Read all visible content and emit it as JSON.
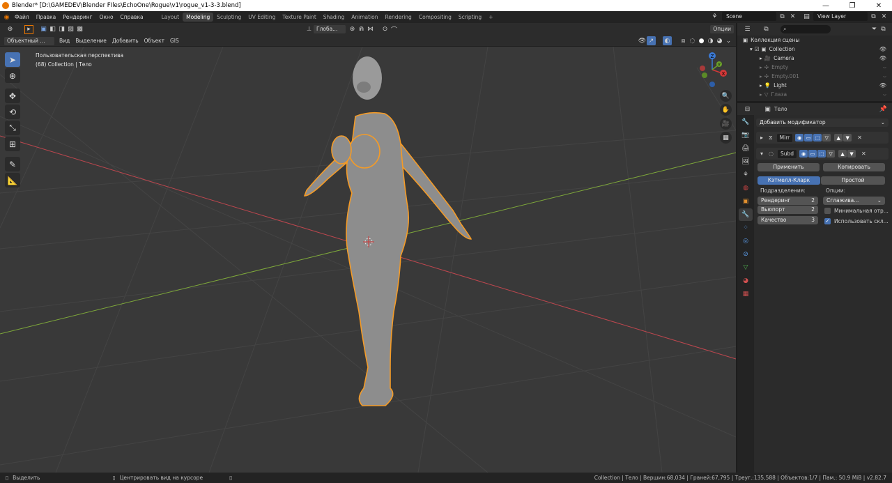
{
  "window": {
    "title": "Blender* [D:\\GAMEDEV\\Blender FIles\\EchoOne\\Rogue\\v1\\rogue_v1-3-3.blend]",
    "controls": [
      "—",
      "❐",
      "✕"
    ]
  },
  "topbar": {
    "menus": [
      "Файл",
      "Правка",
      "Рендеринг",
      "Окно",
      "Справка"
    ],
    "workspaces": [
      "Layout",
      "Modeling",
      "Sculpting",
      "UV Editing",
      "Texture Paint",
      "Shading",
      "Animation",
      "Rendering",
      "Compositing",
      "Scripting"
    ],
    "active_workspace": "Modeling",
    "add_tab": "+",
    "scene": "Scene",
    "view_layer": "View Layer"
  },
  "viewport_header": {
    "transform_orientation": "Глоба...",
    "options": "Опции",
    "mode": "Объектный ...",
    "menus": [
      "Вид",
      "Выделение",
      "Добавить",
      "Объект",
      "GIS"
    ]
  },
  "viewport": {
    "perspective_label": "Пользовательская перспектива",
    "collection_label": "(68) Collection | Тело",
    "gizmo": {
      "x": "X",
      "y": "Y",
      "z": "Z"
    },
    "colors": {
      "background": "#393939",
      "x_axis": "#c0474f",
      "y_axis": "#7ea83a",
      "selection": "#f49b27"
    }
  },
  "outliner": {
    "search_placeholder": "",
    "root": "Коллекция сцены",
    "items": [
      {
        "name": "Collection",
        "visible": true
      },
      {
        "name": "Camera",
        "visible": true
      },
      {
        "name": "Empty",
        "visible": false
      },
      {
        "name": "Empty.001",
        "visible": false
      },
      {
        "name": "Light",
        "visible": true
      },
      {
        "name": "Глаза",
        "visible": false
      }
    ]
  },
  "properties": {
    "object_name": "Тело",
    "add_modifier": "Добавить модификатор",
    "modifiers": [
      {
        "name": "Mirr",
        "expanded": false
      },
      {
        "name": "Subd",
        "expanded": true
      }
    ],
    "apply": "Применить",
    "copy": "Копировать",
    "subdiv_type_active": "Кэтмелл-Кларк",
    "subdiv_type_other": "Простой",
    "subdivisions_label": "Подразделения:",
    "options_label": "Опции:",
    "fields": [
      {
        "label": "Рендеринг",
        "value": "2"
      },
      {
        "label": "Вьюпорт",
        "value": "2"
      },
      {
        "label": "Качество",
        "value": "3"
      }
    ],
    "uv_smooth": "Сглажива...",
    "min_offset": "Минимальная отр...",
    "use_limit": "Использовать скл..."
  },
  "statusbar": {
    "select": "Выделить",
    "center_view": "Центрировать вид на курсоре",
    "stats": "Collection | Тело | Вершин:68,034 | Граней:67,795 | Треуг.:135,588 | Объектов:1/7 | Пам.: 50.9 MiB | v2.82.7"
  }
}
